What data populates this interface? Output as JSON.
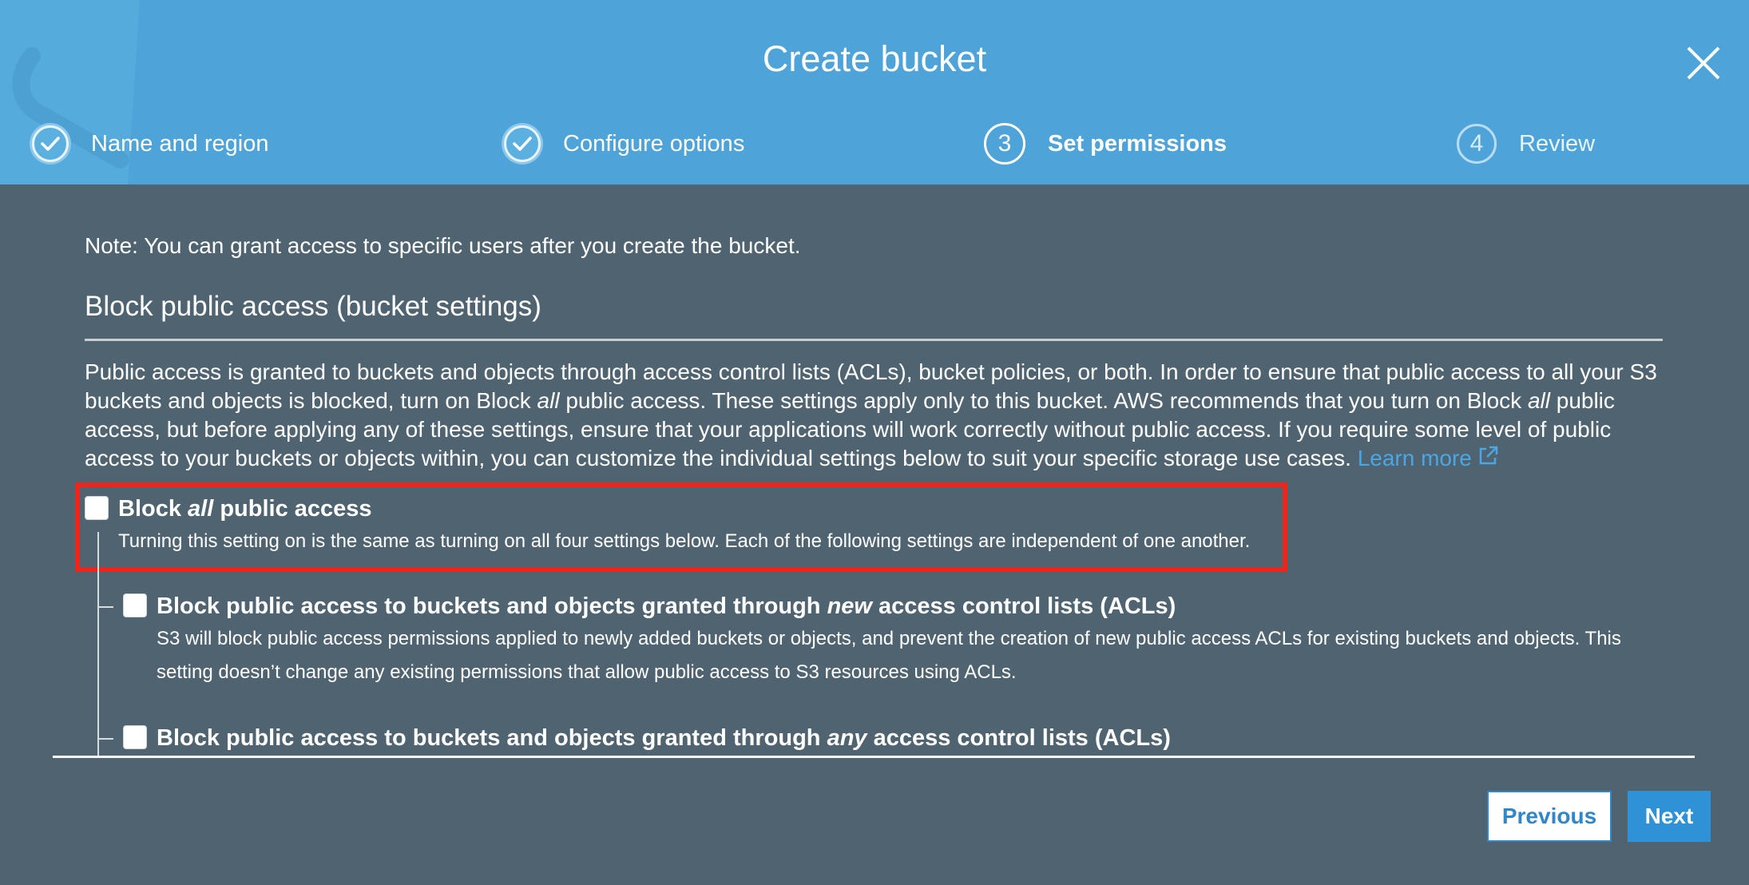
{
  "header": {
    "title": "Create bucket",
    "steps": [
      {
        "number": "1",
        "label": "Name and region",
        "state": "done"
      },
      {
        "number": "2",
        "label": "Configure options",
        "state": "done"
      },
      {
        "number": "3",
        "label": "Set permissions",
        "state": "active"
      },
      {
        "number": "4",
        "label": "Review",
        "state": "todo"
      }
    ]
  },
  "content": {
    "note": "Note: You can grant access to specific users after you create the bucket.",
    "section_title": "Block public access (bucket settings)",
    "description": {
      "part1": "Public access is granted to buckets and objects through access control lists (ACLs), bucket policies, or both. In order to ensure that public access to all your S3 buckets and objects is blocked, turn on Block ",
      "em1": "all",
      "part2": " public access. These settings apply only to this bucket. AWS recommends that you turn on Block ",
      "em2": "all",
      "part3": " public access, but before applying any of these settings, ensure that your applications will work correctly without public access. If you require some level of public access to your buckets or objects within, you can customize the individual settings below to suit your specific storage use cases. ",
      "learn_more": "Learn more"
    },
    "options": [
      {
        "label_before": "Block ",
        "label_em": "all",
        "label_after": " public access",
        "description": "Turning this setting on is the same as turning on all four settings below. Each of the following settings are independent of one another.",
        "checked": false
      },
      {
        "label_before": "Block public access to buckets and objects granted through ",
        "label_em": "new",
        "label_after": " access control lists (ACLs)",
        "description": "S3 will block public access permissions applied to newly added buckets or objects, and prevent the creation of new public access ACLs for existing buckets and objects. This setting doesn’t change any existing permissions that allow public access to S3 resources using ACLs.",
        "checked": false
      },
      {
        "label_before": "Block public access to buckets and objects granted through ",
        "label_em": "any",
        "label_after": " access control lists (ACLs)",
        "checked": false
      }
    ]
  },
  "footer": {
    "previous_label": "Previous",
    "next_label": "Next"
  },
  "colors": {
    "header_bg": "#4ea4d8",
    "body_bg": "#4f6470",
    "highlight": "#e8271e",
    "link": "#4ba6e6",
    "primary_button": "#2f92d6"
  },
  "icons": [
    "check-icon",
    "close-icon",
    "external-link-icon"
  ]
}
